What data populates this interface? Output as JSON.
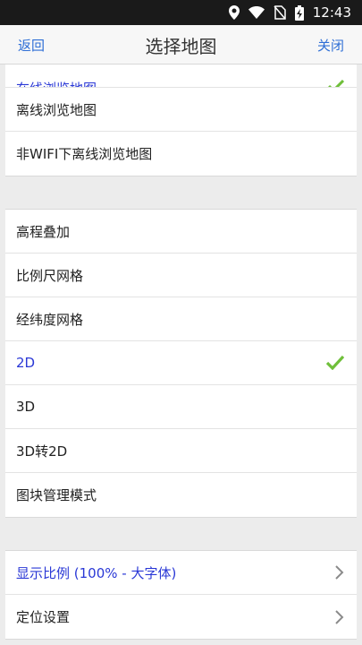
{
  "status": {
    "time": "12:43"
  },
  "nav": {
    "back": "返回",
    "title": "选择地图",
    "close": "关闭"
  },
  "group1": [
    {
      "label": "在线浏览地图",
      "selected": true
    },
    {
      "label": "离线浏览地图"
    },
    {
      "label": "非WIFI下离线浏览地图"
    }
  ],
  "group2": [
    {
      "label": "高程叠加"
    },
    {
      "label": "比例尺网格"
    },
    {
      "label": "经纬度网格"
    },
    {
      "label": "2D",
      "selected": true
    },
    {
      "label": "3D"
    },
    {
      "label": "3D转2D"
    },
    {
      "label": "图块管理模式"
    }
  ],
  "group3": [
    {
      "label": "显示比例 (100% - 大字体)"
    },
    {
      "label": "定位设置"
    }
  ],
  "colors": {
    "accent": "#2f6fd6",
    "selected_text": "#2a38d6",
    "check": "#6fbf3a"
  }
}
